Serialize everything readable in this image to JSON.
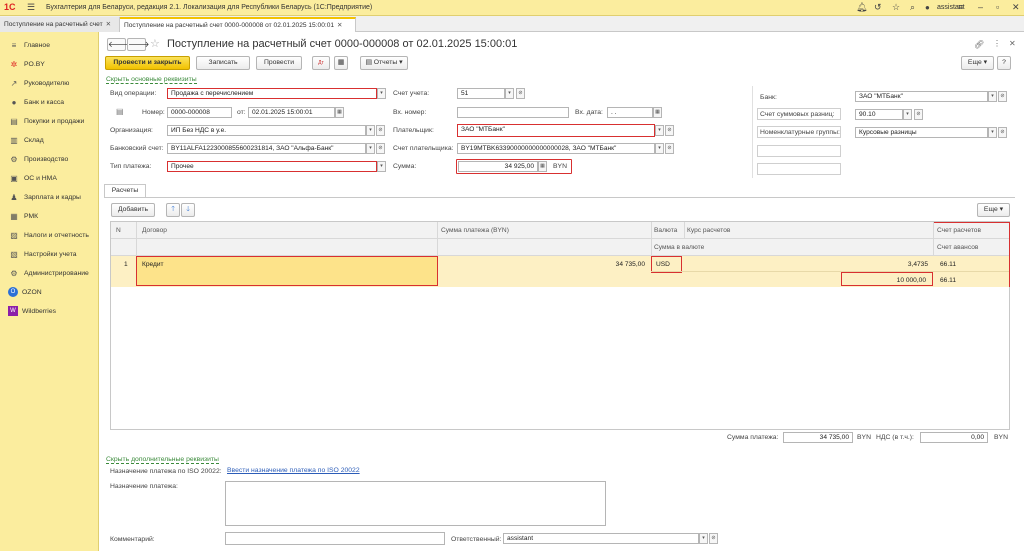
{
  "app": {
    "logo": "1С",
    "title": "Бухгалтерия для Беларуси, редакция 2.1. Локализация для Республики Беларусь  (1С:Предприятие)",
    "user": "assistant"
  },
  "tabs": [
    {
      "label": "Поступление на расчетный счет"
    },
    {
      "label": "Поступление на расчетный счет 0000-000008 от 02.01.2025 15:00:01"
    }
  ],
  "sidebar": {
    "items": [
      {
        "label": "Главное",
        "icon": "≡"
      },
      {
        "label": "PO.BY",
        "icon": "✲"
      },
      {
        "label": "Руководителю",
        "icon": "↗"
      },
      {
        "label": "Банк и касса",
        "icon": "●"
      },
      {
        "label": "Покупки и продажи",
        "icon": "▤"
      },
      {
        "label": "Склад",
        "icon": "▥"
      },
      {
        "label": "Производство",
        "icon": "⚙"
      },
      {
        "label": "ОС и НМА",
        "icon": "▣"
      },
      {
        "label": "Зарплата и кадры",
        "icon": "♟"
      },
      {
        "label": "РМК",
        "icon": "▦"
      },
      {
        "label": "Налоги и отчетность",
        "icon": "▨"
      },
      {
        "label": "Настройки учета",
        "icon": "▧"
      },
      {
        "label": "Администрирование",
        "icon": "⚙"
      },
      {
        "label": "OZON",
        "icon": "O"
      },
      {
        "label": "Wildberries",
        "icon": "W"
      }
    ]
  },
  "document": {
    "title": "Поступление на расчетный счет 0000-000008 от 02.01.2025 15:00:01",
    "toolbar": {
      "post_close": "Провести и закрыть",
      "save": "Записать",
      "post": "Провести",
      "reports": "Отчеты",
      "more": "Еще"
    },
    "hide_main": "Скрыть основные реквизиты",
    "fields": {
      "operation_type_label": "Вид операции:",
      "operation_type": "Продажа с перечислением",
      "number_label": "Номер:",
      "number": "0000-000008",
      "date_label": "от:",
      "date": "02.01.2025 15:00:01",
      "org_label": "Организация:",
      "org": "ИП Без НДС в у.е.",
      "bank_account_label": "Банковский счет:",
      "bank_account": "BY11ALFA12230008556002318​14, ЗАО \"Альфа-Банк\"",
      "payment_type_label": "Тип платежа:",
      "payment_type": "Прочее",
      "account_label": "Счет учета:",
      "account": "51",
      "in_number_label": "Вх. номер:",
      "in_number": "",
      "in_date_label": "Вх. дата:",
      "in_date": ". .",
      "payer_label": "Плательщик:",
      "payer": "ЗАО \"МТБанк\"",
      "payer_account_label": "Счет плательщика:",
      "payer_account": "BY19MTBK63390000000000000028, ЗАО \"МТБанк\"",
      "sum_label": "Сумма:",
      "sum": "34 925,00",
      "currency": "BYN",
      "bank_label": "Банк:",
      "bank": "ЗАО \"МТБанк\"",
      "sum_diff_label": "Счет суммовых разниц:",
      "sum_diff": "90.10",
      "nomen_label": "Номенклатурные группы:",
      "nomen": "Курсовые разницы"
    },
    "tab_settlements": "Расчеты",
    "add": "Добавить",
    "grid": {
      "headers": {
        "n": "N",
        "contract": "Договор",
        "payment_sum": "Сумма платежа (BYN)",
        "currency": "Валюта",
        "rate": "Курс расчетов",
        "sum_currency": "Сумма в валюте",
        "account_settle": "Счет расчетов",
        "account_adv": "Счет авансов"
      },
      "rows": [
        {
          "n": "1",
          "contract": "Кредит",
          "payment_sum": "34 735,00",
          "currency": "USD",
          "rate": "3,4735",
          "sum_currency": "10 000,00",
          "account_settle": "66.11",
          "account_adv": "66.11"
        }
      ]
    },
    "totals": {
      "payment_sum_label": "Сумма платежа:",
      "payment_sum": "34 735,00",
      "currency": "BYN",
      "vat_label": "НДС (в т.ч.):",
      "vat": "0,00",
      "vat_currency": "BYN"
    },
    "hide_extra": "Скрыть дополнительные реквизиты",
    "iso_label": "Назначение платежа по ISO 20022:",
    "iso_link": "Ввести назначение платежа по ISO 20022",
    "purpose_label": "Назначение платежа:",
    "purpose": "",
    "comment_label": "Комментарий:",
    "comment": "",
    "responsible_label": "Ответственный:",
    "responsible": "assistant"
  }
}
